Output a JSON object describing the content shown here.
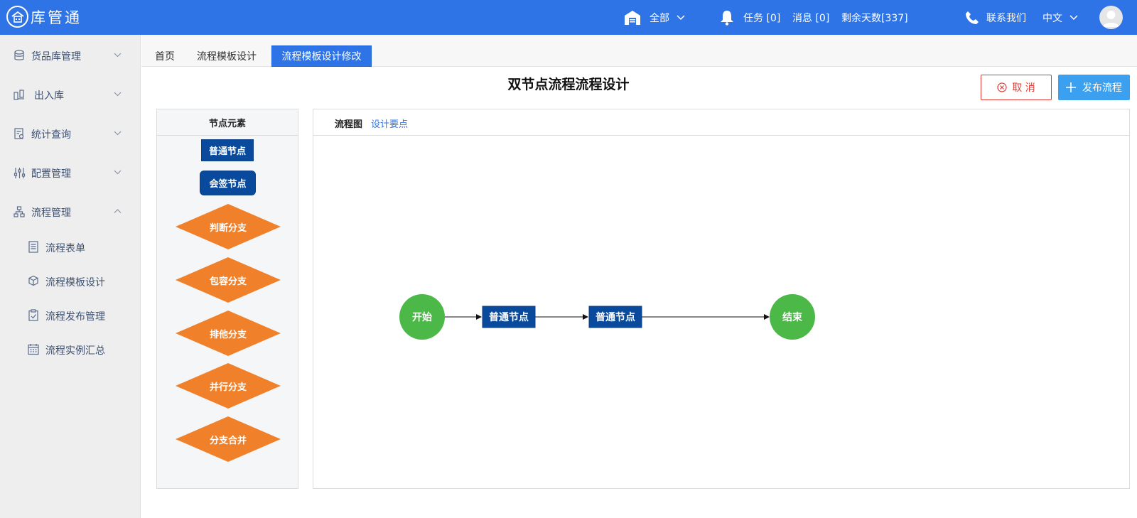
{
  "header": {
    "logo_text": "库管通",
    "warehouse_label": "全部",
    "task_label": "任务 [0]",
    "message_label": "消息 [0]",
    "days_left_label": "剩余天数[337]",
    "contact_label": "联系我们",
    "language_label": "中文"
  },
  "sidebar": {
    "items": [
      {
        "label": "货品库管理",
        "icon": "database-icon",
        "expanded": false
      },
      {
        "label": "出入库",
        "icon": "transfer-icon",
        "expanded": false
      },
      {
        "label": "统计查询",
        "icon": "stats-icon",
        "expanded": false
      },
      {
        "label": "配置管理",
        "icon": "sliders-icon",
        "expanded": false
      },
      {
        "label": "流程管理",
        "icon": "org-chart-icon",
        "expanded": true
      }
    ],
    "sub_items": [
      {
        "label": "流程表单",
        "icon": "document-icon"
      },
      {
        "label": "流程模板设计",
        "icon": "cube-icon"
      },
      {
        "label": "流程发布管理",
        "icon": "clipboard-icon"
      },
      {
        "label": "流程实例汇总",
        "icon": "calendar-icon"
      }
    ]
  },
  "tabs": [
    {
      "label": "首页",
      "active": false
    },
    {
      "label": "流程模板设计",
      "active": false
    },
    {
      "label": "流程模板设计修改",
      "active": true
    }
  ],
  "main": {
    "title": "双节点流程流程设计",
    "cancel_label": "取 消",
    "publish_label": "发布流程"
  },
  "palette": {
    "title": "节点元素",
    "normal_node": "普通节点",
    "countersign_node": "会签节点",
    "diamonds": [
      "判断分支",
      "包容分支",
      "排他分支",
      "并行分支",
      "分支合并"
    ]
  },
  "canvas": {
    "tab_flowchart": "流程图",
    "tab_design_notes": "设计要点",
    "nodes": {
      "start": "开始",
      "node1": "普通节点",
      "node2": "普通节点",
      "end": "结束"
    }
  },
  "colors": {
    "header_bg": "#2f74e6",
    "node_blue": "#0a4a9c",
    "diamond_orange": "#f0812a",
    "circle_green": "#4cb848",
    "cancel_red": "#e53935",
    "publish_blue": "#3aa0ef"
  }
}
